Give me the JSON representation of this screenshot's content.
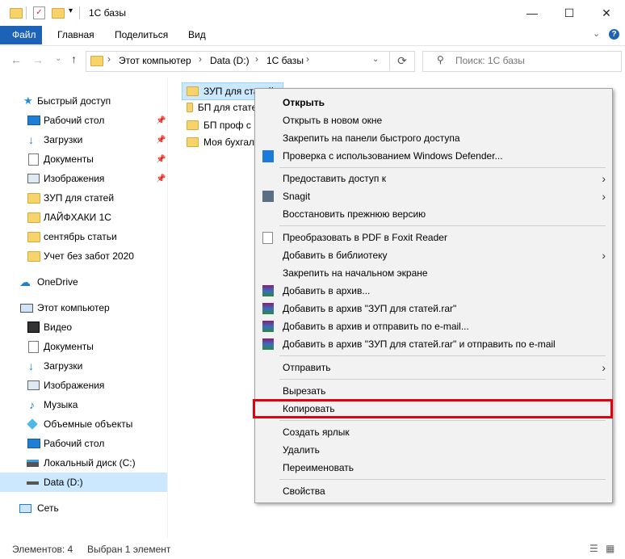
{
  "window": {
    "title": "1С базы",
    "buttons": {
      "minimize": "—",
      "maximize": "☐",
      "close": "✕"
    }
  },
  "ribbon": {
    "tabs": [
      "Файл",
      "Главная",
      "Поделиться",
      "Вид"
    ],
    "expand_icon": "chevron-down",
    "help_icon": "help"
  },
  "address": {
    "crumbs": [
      "Этот компьютер",
      "Data (D:)",
      "1С базы"
    ],
    "search_placeholder": "Поиск: 1С базы"
  },
  "nav": {
    "quick_access": "Быстрый доступ",
    "pinned": [
      "Рабочий стол",
      "Загрузки",
      "Документы",
      "Изображения"
    ],
    "recent": [
      "ЗУП для статей",
      "ЛАЙФХАКИ 1С",
      "сентябрь статьи",
      "Учет без забот 2020"
    ],
    "onedrive": "OneDrive",
    "this_pc": "Этот компьютер",
    "pc_items": [
      "Видео",
      "Документы",
      "Загрузки",
      "Изображения",
      "Музыка",
      "Объемные объекты",
      "Рабочий стол",
      "Локальный диск (C:)",
      "Data (D:)"
    ],
    "network": "Сеть"
  },
  "files": [
    "ЗУП для статей",
    "БП для статей",
    "БП проф с И",
    "Моя бухгалт"
  ],
  "context_menu": {
    "open": "Открыть",
    "open_new_window": "Открыть в новом окне",
    "pin_quick": "Закрепить на панели быстрого доступа",
    "defender": "Проверка с использованием Windows Defender...",
    "give_access": "Предоставить доступ к",
    "snagit": "Snagit",
    "restore": "Восстановить прежнюю версию",
    "foxit": "Преобразовать в PDF в Foxit Reader",
    "add_library": "Добавить в библиотеку",
    "pin_start": "Закрепить на начальном экране",
    "rar_add": "Добавить в архив...",
    "rar_add_named": "Добавить в архив \"ЗУП для статей.rar\"",
    "rar_add_email": "Добавить в архив и отправить по e-mail...",
    "rar_add_named_email": "Добавить в архив \"ЗУП для статей.rar\" и отправить по e-mail",
    "send_to": "Отправить",
    "cut": "Вырезать",
    "copy": "Копировать",
    "create_shortcut": "Создать ярлык",
    "delete": "Удалить",
    "rename": "Переименовать",
    "properties": "Свойства"
  },
  "status": {
    "count": "Элементов: 4",
    "selected": "Выбран 1 элемент"
  },
  "colors": {
    "file_tab": "#1c63b7",
    "selection": "#cce8ff",
    "highlight_box": "#e3000f",
    "folder": "#f6d36b"
  }
}
